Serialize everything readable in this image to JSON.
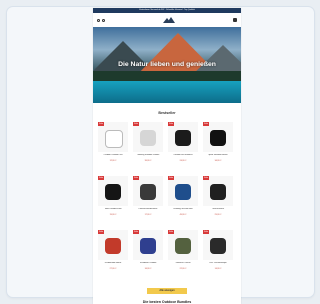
{
  "topbar": {
    "text": "Kostenloser Versand ab 50€ · Schneller Versand · Top Qualität"
  },
  "hero": {
    "title": "Die Natur lieben und genießen"
  },
  "bestseller": {
    "title": "Bestseller"
  },
  "products": [
    {
      "name": "Outdoor Zubehör Set",
      "price": "12,99 €",
      "badge": "Sale",
      "color": "#ffffff"
    },
    {
      "name": "Trekking Sandale Damen",
      "price": "39,99 €",
      "badge": "Sale",
      "color": "#d6d6d6"
    },
    {
      "name": "Outdoor Hut Sommer",
      "price": "24,99 €",
      "badge": "Sale",
      "color": "#1b1b1b"
    },
    {
      "name": "Sport Sandale Herren",
      "price": "34,99 €",
      "badge": "Sale",
      "color": "#111111"
    },
    {
      "name": "Touch Handschuhe",
      "price": "19,99 €",
      "badge": "Sale",
      "color": "#151515"
    },
    {
      "name": "Fahrrad Handschuhe",
      "price": "17,99 €",
      "badge": "Sale",
      "color": "#3a3a3a"
    },
    {
      "name": "Running Schuhe Blau",
      "price": "49,99 €",
      "badge": "Sale",
      "color": "#1f4e8c"
    },
    {
      "name": "Trinkrucksack",
      "price": "29,99 €",
      "badge": "Sale",
      "color": "#202020"
    },
    {
      "name": "Kurbelradio Notfall",
      "price": "27,99 €",
      "badge": "Sale",
      "color": "#c23a2a"
    },
    {
      "name": "Trinkblase Outdoor",
      "price": "16,99 €",
      "badge": "Sale",
      "color": "#2f3f8f"
    },
    {
      "name": "Taktische Tasche",
      "price": "22,99 €",
      "badge": "Sale",
      "color": "#54613f"
    },
    {
      "name": "LED Taschenlampe",
      "price": "14,99 €",
      "badge": "Sale",
      "color": "#2a2a2a"
    }
  ],
  "cta": {
    "label": "Alle anzeigen"
  },
  "subtitle": "Die besten Outdoor Bundles"
}
